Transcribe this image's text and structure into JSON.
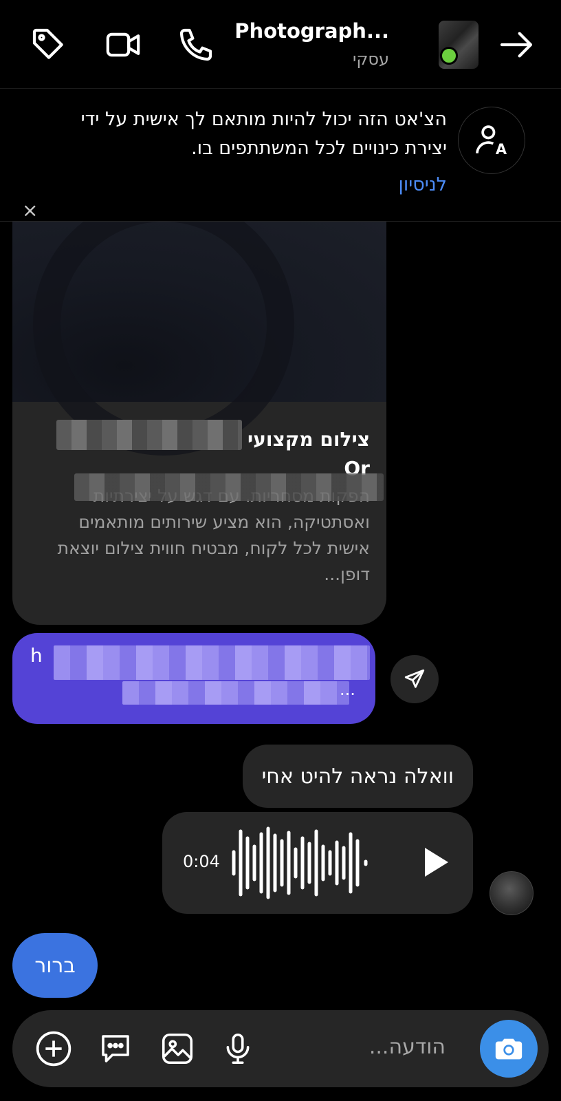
{
  "header": {
    "title": "Photograph...",
    "subtitle": "עסקי",
    "icons": [
      "tag-icon",
      "video-call-icon",
      "phone-icon",
      "arrow-right-icon"
    ]
  },
  "banner": {
    "text": "הצ'אט הזה יכול להיות מותאם לך אישית על ידי יצירת כינויים לכל המשתתפים בו.",
    "link": "לניסיון",
    "close": "×"
  },
  "shared_post": {
    "title_visible": "צילום מקצועי ה",
    "title_tail": "Or",
    "description_visible": "הפקות מסחריות. עם דגש על יצירתיות ואסתטיקה, הוא מציע שירותים מותאמים אישית לכל לקוח, מבטיח חווית צילום יוצאת דופן..."
  },
  "messages": {
    "purple_prefix": "h",
    "purple_suffix": "...",
    "outgoing_text": "וואלה נראה להיט אחי",
    "voice_duration": "0:04",
    "incoming_text": "ברור"
  },
  "composer": {
    "placeholder": "הודעה..."
  },
  "colors": {
    "link": "#4c8bf5",
    "purple": "#5443d6",
    "incoming": "#3b73e0",
    "camera": "#3b8fe8",
    "online": "#6ccf3f"
  }
}
